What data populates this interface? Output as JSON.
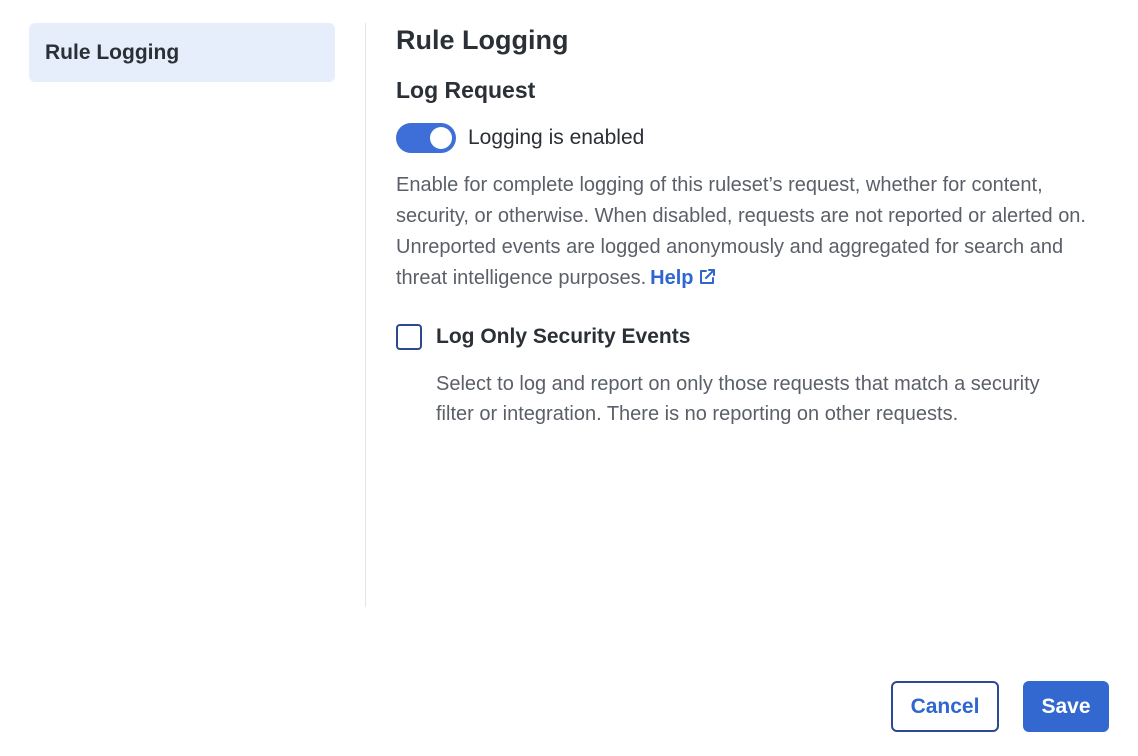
{
  "sidebar": {
    "items": [
      {
        "label": "Rule Logging",
        "active": true
      }
    ]
  },
  "main": {
    "title": "Rule Logging",
    "section_title": "Log Request",
    "toggle": {
      "label": "Logging is enabled",
      "enabled": true
    },
    "description": "Enable for complete logging of this ruleset’s request, whether for content, security, or otherwise. When disabled, requests are not reported or alerted on. Unreported events are logged anonymously and aggregated for search and threat intelligence purposes.",
    "help_link": "Help",
    "security_checkbox": {
      "label": "Log Only Security Events",
      "checked": false,
      "description": "Select to log and report on only those requests that match a security filter or integration. There is no reporting on other requests."
    }
  },
  "footer": {
    "cancel_label": "Cancel",
    "save_label": "Save"
  },
  "colors": {
    "accent": "#3268cf",
    "sidebar_active_bg": "#e6eefc",
    "link": "#2f66d0"
  },
  "icons": {
    "help_link_icon": "external-link-icon"
  }
}
